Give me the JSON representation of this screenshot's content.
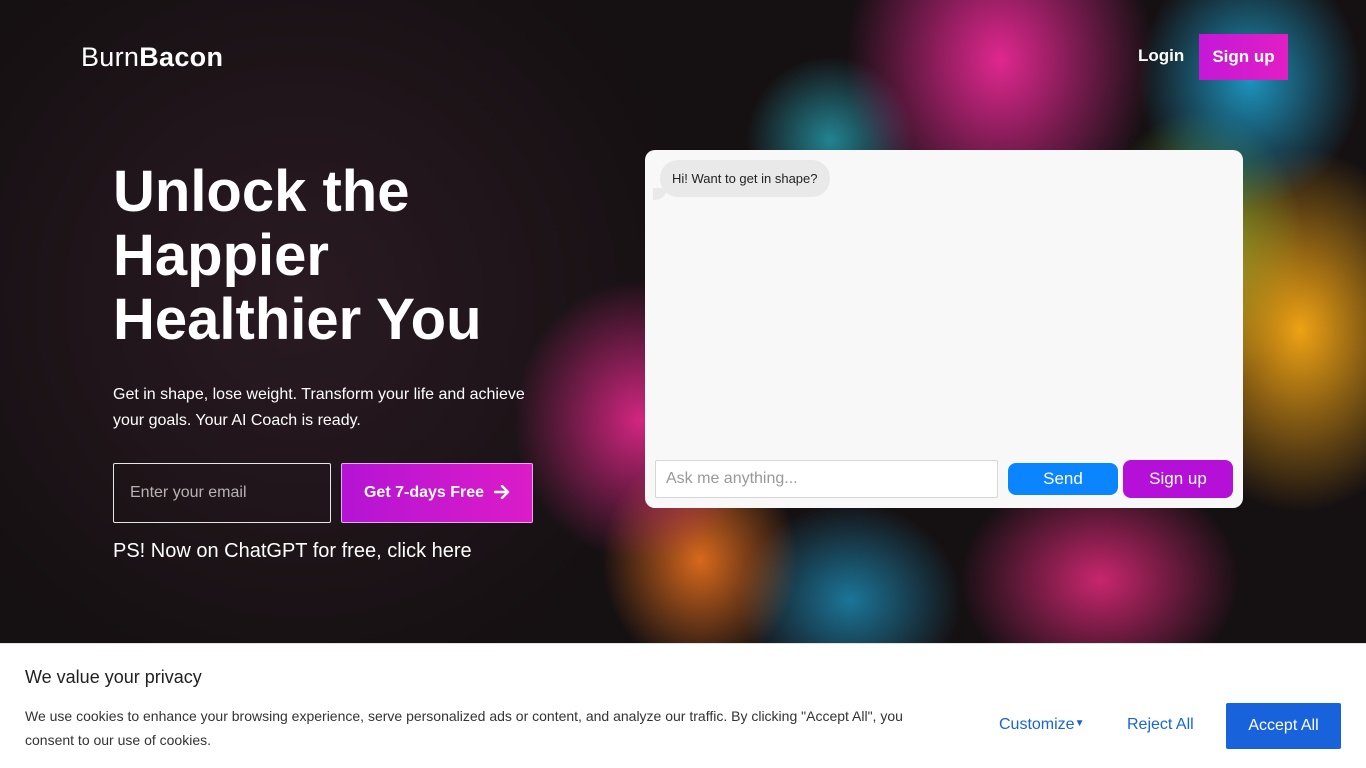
{
  "brand": {
    "name_light": "Burn",
    "name_bold": "Bacon"
  },
  "nav": {
    "login_label": "Login",
    "signup_label": "Sign up"
  },
  "hero": {
    "headline_line1": "Unlock the",
    "headline_line2": "Happier",
    "headline_line3": "Healthier You",
    "subtitle": "Get in shape, lose weight. Transform your life and achieve your goals. Your AI Coach is ready.",
    "email_placeholder": "Enter your email",
    "cta_label": "Get 7-days Free",
    "ps_text": "PS! Now on ChatGPT for free, click here"
  },
  "chat": {
    "greeting": "Hi! Want to get in shape?",
    "input_placeholder": "Ask me anything...",
    "send_label": "Send",
    "signup_label": "Sign up"
  },
  "cookie_banner": {
    "title": "We value your privacy",
    "text": "We use cookies to enhance your browsing experience, serve personalized ads or content, and analyze our traffic. By clicking \"Accept All\", you consent to our use of cookies.",
    "customize_label": "Customize",
    "reject_label": "Reject All",
    "accept_label": "Accept All"
  },
  "icons": {
    "cta_icon": "arrow-right-icon",
    "customize_icon": "caret-down-icon"
  },
  "colors": {
    "accent_magenta": "#c418d8",
    "send_blue": "#0a84ff",
    "cookie_blue": "#1863dc"
  }
}
